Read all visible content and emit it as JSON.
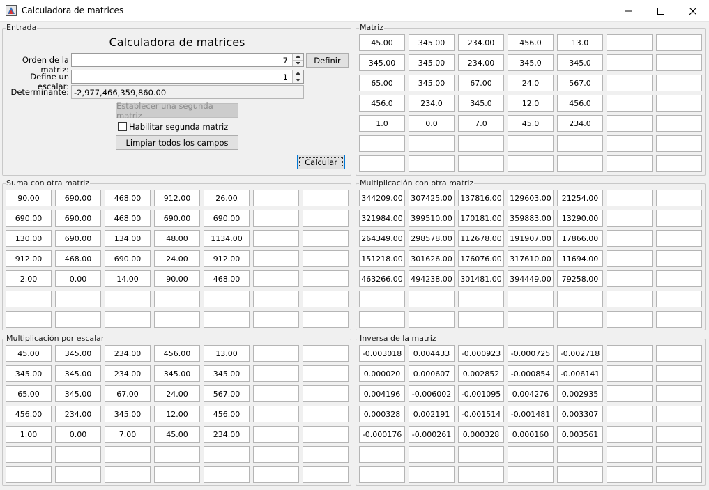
{
  "window": {
    "title": "Calculadora de matrices",
    "icon": "matrix-app-icon",
    "controls": [
      "minimize-icon",
      "maximize-icon",
      "close-icon"
    ]
  },
  "entrada": {
    "legend": "Entrada",
    "heading": "Calculadora de matrices",
    "order_label": "Orden de la matriz:",
    "order_value": "7",
    "define_button": "Definir",
    "scalar_label": "Define un escalar:",
    "scalar_value": "1",
    "determinant_label": "Determinante:",
    "determinant_value": "-2,977,466,359,860.00",
    "second_matrix_button": "Establecer una segunda matriz",
    "enable_second_label": "Habilitar segunda matriz",
    "enable_second_checked": false,
    "clear_button": "Limpiar todos los campos",
    "calculate_button": "Calcular"
  },
  "matrices": [
    {
      "id": "matriz",
      "legend": "Matriz",
      "rows": [
        [
          "45.00",
          "345.00",
          "234.00",
          "456.0",
          "13.0",
          "",
          ""
        ],
        [
          "345.00",
          "345.00",
          "234.00",
          "345.0",
          "345.0",
          "",
          ""
        ],
        [
          "65.00",
          "345.00",
          "67.00",
          "24.0",
          "567.0",
          "",
          ""
        ],
        [
          "456.0",
          "234.0",
          "345.0",
          "12.0",
          "456.0",
          "",
          ""
        ],
        [
          "1.0",
          "0.0",
          "7.0",
          "45.0",
          "234.0",
          "",
          ""
        ],
        [
          "",
          "",
          "",
          "",
          "",
          "",
          ""
        ],
        [
          "",
          "",
          "",
          "",
          "",
          "",
          ""
        ]
      ]
    },
    {
      "id": "suma",
      "legend": "Suma con otra matriz",
      "rows": [
        [
          "90.00",
          "690.00",
          "468.00",
          "912.00",
          "26.00",
          "",
          ""
        ],
        [
          "690.00",
          "690.00",
          "468.00",
          "690.00",
          "690.00",
          "",
          ""
        ],
        [
          "130.00",
          "690.00",
          "134.00",
          "48.00",
          "1134.00",
          "",
          ""
        ],
        [
          "912.00",
          "468.00",
          "690.00",
          "24.00",
          "912.00",
          "",
          ""
        ],
        [
          "2.00",
          "0.00",
          "14.00",
          "90.00",
          "468.00",
          "",
          ""
        ],
        [
          "",
          "",
          "",
          "",
          "",
          "",
          ""
        ],
        [
          "",
          "",
          "",
          "",
          "",
          "",
          ""
        ]
      ]
    },
    {
      "id": "multiplicacion",
      "legend": "Multiplicación con otra matriz",
      "rows": [
        [
          "344209.00",
          "307425.00",
          "137816.00",
          "129603.00",
          "21254.00",
          "",
          ""
        ],
        [
          "321984.00",
          "399510.00",
          "170181.00",
          "359883.00",
          "13290.00",
          "",
          ""
        ],
        [
          "264349.00",
          "298578.00",
          "112678.00",
          "191907.00",
          "17866.00",
          "",
          ""
        ],
        [
          "151218.00",
          "301626.00",
          "176076.00",
          "317610.00",
          "11694.00",
          "",
          ""
        ],
        [
          "463266.00",
          "494238.00",
          "301481.00",
          "394449.00",
          "79258.00",
          "",
          ""
        ],
        [
          "",
          "",
          "",
          "",
          "",
          "",
          ""
        ],
        [
          "",
          "",
          "",
          "",
          "",
          "",
          ""
        ]
      ]
    },
    {
      "id": "escalar",
      "legend": "Multiplicación por escalar",
      "rows": [
        [
          "45.00",
          "345.00",
          "234.00",
          "456.00",
          "13.00",
          "",
          ""
        ],
        [
          "345.00",
          "345.00",
          "234.00",
          "345.00",
          "345.00",
          "",
          ""
        ],
        [
          "65.00",
          "345.00",
          "67.00",
          "24.00",
          "567.00",
          "",
          ""
        ],
        [
          "456.00",
          "234.00",
          "345.00",
          "12.00",
          "456.00",
          "",
          ""
        ],
        [
          "1.00",
          "0.00",
          "7.00",
          "45.00",
          "234.00",
          "",
          ""
        ],
        [
          "",
          "",
          "",
          "",
          "",
          "",
          ""
        ],
        [
          "",
          "",
          "",
          "",
          "",
          "",
          ""
        ]
      ]
    },
    {
      "id": "inversa",
      "legend": "Inversa de la matriz",
      "rows": [
        [
          "-0.003018",
          "0.004433",
          "-0.000923",
          "-0.000725",
          "-0.002718",
          "",
          ""
        ],
        [
          "0.000020",
          "0.000607",
          "0.002852",
          "-0.000854",
          "-0.006141",
          "",
          ""
        ],
        [
          "0.004196",
          "-0.006002",
          "-0.001095",
          "0.004276",
          "0.002935",
          "",
          ""
        ],
        [
          "0.000328",
          "0.002191",
          "-0.001514",
          "-0.001481",
          "0.003307",
          "",
          ""
        ],
        [
          "-0.000176",
          "-0.000261",
          "0.000328",
          "0.000160",
          "0.003561",
          "",
          ""
        ],
        [
          "",
          "",
          "",
          "",
          "",
          "",
          ""
        ],
        [
          "",
          "",
          "",
          "",
          "",
          "",
          ""
        ]
      ]
    }
  ]
}
